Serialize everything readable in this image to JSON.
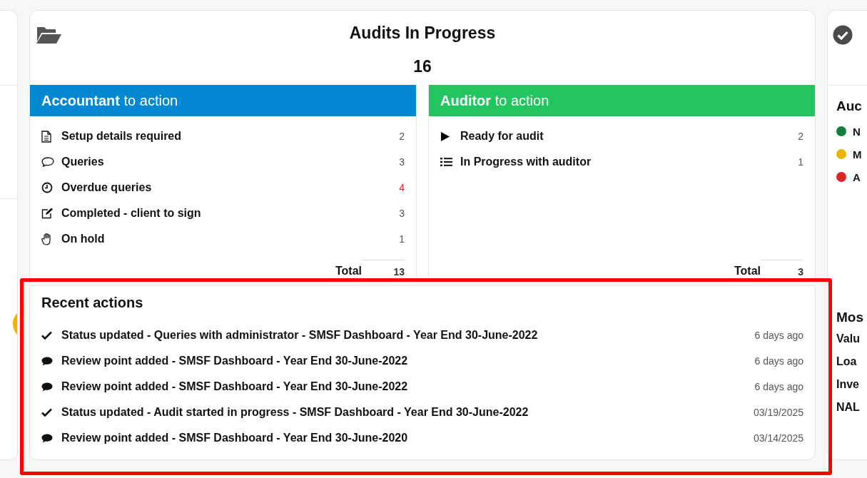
{
  "main": {
    "title": "Audits In Progress",
    "count": "16",
    "panels": [
      {
        "kind": "accountant",
        "title": "**Accountant** to action",
        "total_label": "Total",
        "total": "13",
        "items": [
          {
            "kind": "document",
            "label": "Setup details required",
            "count": "2",
            "alert": false
          },
          {
            "kind": "comment",
            "label": "Queries",
            "count": "3",
            "alert": false
          },
          {
            "kind": "clock",
            "label": "Overdue queries",
            "count": "4",
            "alert": true
          },
          {
            "kind": "edit",
            "label": "Completed - client to sign",
            "count": "3",
            "alert": false
          },
          {
            "kind": "hand",
            "label": "On hold",
            "count": "1",
            "alert": false
          }
        ]
      },
      {
        "kind": "auditor",
        "title": "**Auditor** to action",
        "total_label": "Total",
        "total": "3",
        "items": [
          {
            "kind": "play",
            "label": "Ready for audit",
            "count": "2",
            "alert": false
          },
          {
            "kind": "list",
            "label": "In Progress with auditor",
            "count": "1",
            "alert": false
          }
        ]
      }
    ]
  },
  "recent": {
    "title": "Recent actions",
    "items": [
      {
        "kind": "status",
        "text": "Status updated - Queries with administrator - SMSF Dashboard - Year End 30-June-2022",
        "time": "6 days ago"
      },
      {
        "kind": "review",
        "text": "Review point added - SMSF Dashboard - Year End 30-June-2022",
        "time": "6 days ago"
      },
      {
        "kind": "review",
        "text": "Review point added - SMSF Dashboard - Year End 30-June-2022",
        "time": "6 days ago"
      },
      {
        "kind": "status",
        "text": "Status updated - Audit started in progress - SMSF Dashboard - Year End 30-June-2022",
        "time": "03/19/2025"
      },
      {
        "kind": "review",
        "text": "Review point added - SMSF Dashboard - Year End 30-June-2020",
        "time": "03/14/2025"
      }
    ]
  },
  "right_card": {
    "heading": "Auc",
    "legend": [
      {
        "label": "N",
        "color": "#15803d"
      },
      {
        "label": "M",
        "color": "#eab308"
      },
      {
        "label": "A",
        "color": "#dc2626"
      }
    ],
    "heading_2": "Mos",
    "rows": [
      "Valu",
      "Loa",
      "Inve",
      "NAL"
    ]
  }
}
